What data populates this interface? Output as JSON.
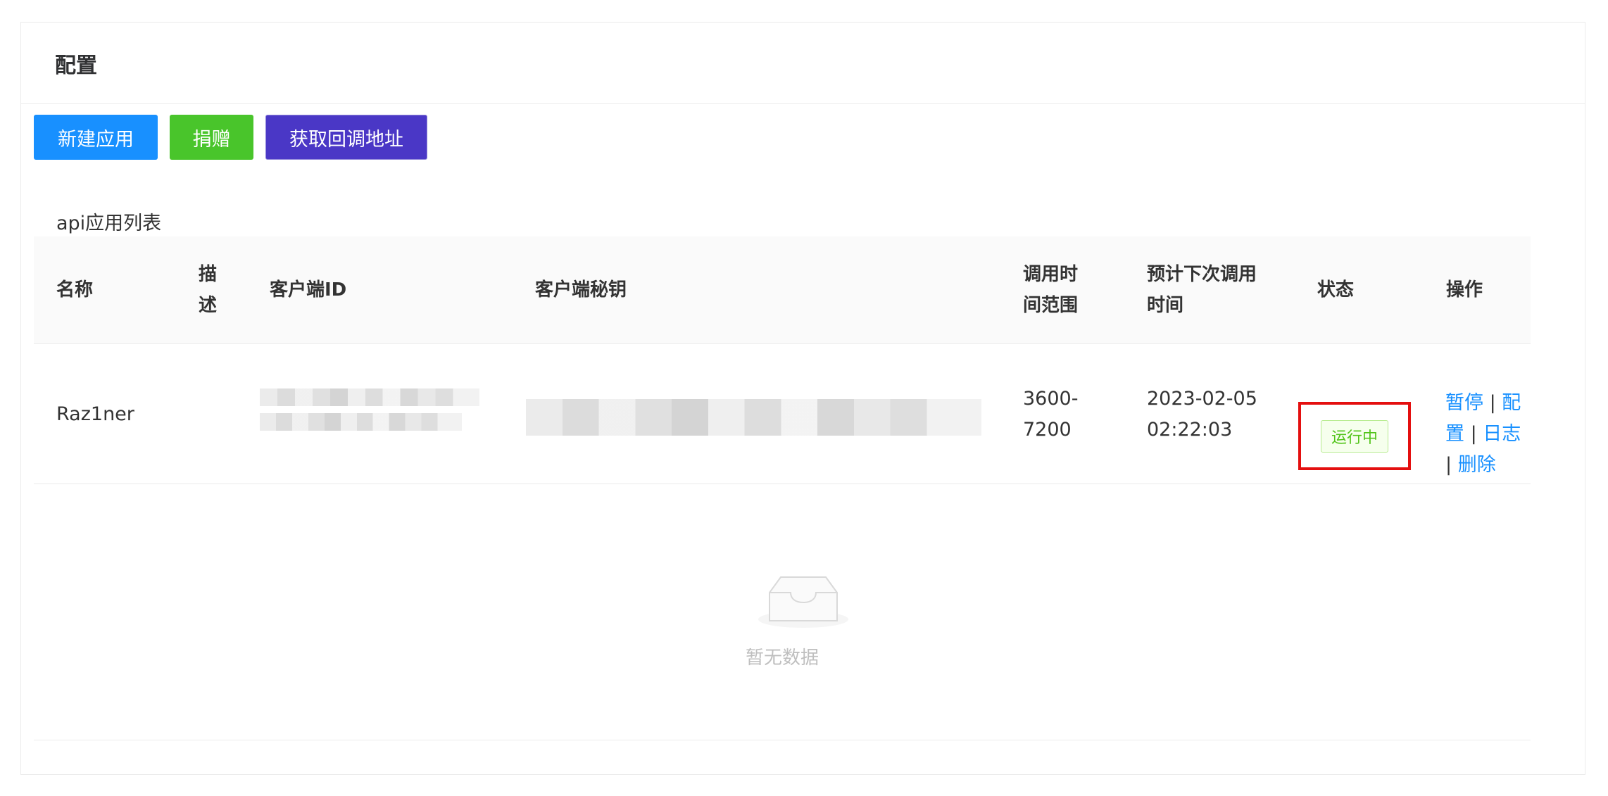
{
  "card": {
    "title": "配置"
  },
  "toolbar": {
    "new_app_label": "新建应用",
    "donate_label": "捐赠",
    "callback_label": "获取回调地址"
  },
  "list": {
    "title": "api应用列表"
  },
  "table": {
    "headers": {
      "name": "名称",
      "desc_line1": "描",
      "desc_line2": "述",
      "client_id": "客户端ID",
      "client_secret": "客户端秘钥",
      "range_line1": "调用时",
      "range_line2": "间范围",
      "next_line1": "预计下次调用",
      "next_line2": "时间",
      "status": "状态",
      "ops": "操作"
    },
    "rows": [
      {
        "name": "Raz1ner",
        "desc": "",
        "range_line1": "3600-",
        "range_line2": "7200",
        "next_line1": "2023-02-05",
        "next_line2": "02:22:03",
        "status": "运行中",
        "op_pause": "暂停",
        "op_config_1": "配",
        "op_config_2": "置",
        "op_log": "日志",
        "op_delete": "删除",
        "separator": "|"
      }
    ]
  },
  "empty": {
    "text": "暂无数据"
  },
  "colors": {
    "primary": "#1890ff",
    "success": "#49c52b",
    "purple": "#4a37c6",
    "highlight": "#e40f0f",
    "status_green": "#52c41a"
  }
}
